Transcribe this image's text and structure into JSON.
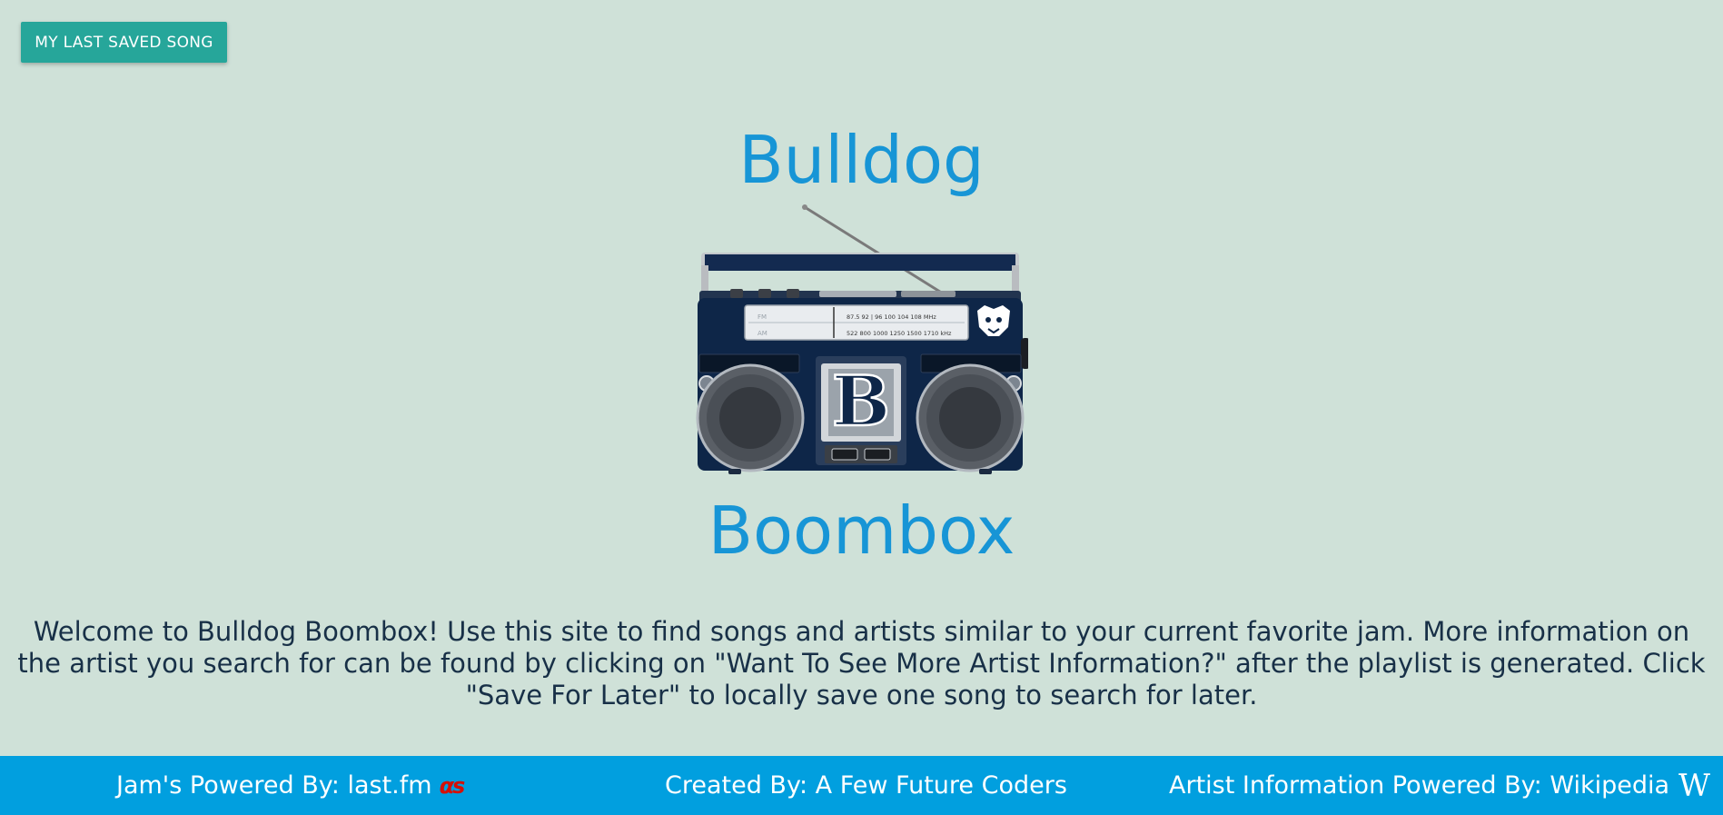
{
  "saved_button": {
    "label": "MY LAST SAVED SONG"
  },
  "title": {
    "line1": "Bulldog",
    "line2": "Boombox"
  },
  "boombox": {
    "letter": "B",
    "fm_label": "FM",
    "am_label": "AM",
    "fm_scale": "87.5  92  |  96   100  104  108   MHz",
    "am_scale": "522  800  1000  1250  1500  1710   kHz"
  },
  "welcome_text": "Welcome to Bulldog Boombox! Use this site to find songs and artists similar to your current favorite jam. More information on the artist you search for can be found by clicking on \"Want To See More Artist Information?\" after the playlist is generated. Click \"Save For Later\" to locally save one song to search for later.",
  "footer": {
    "left_text": "Jam's Powered By: last.fm",
    "left_icon": "lastfm-logo",
    "left_logo_text": "αs",
    "middle_text": "Created By: A Few Future Coders",
    "right_text": "Artist Information Powered By: Wikipedia",
    "right_icon": "wikipedia-logo",
    "right_logo_text": "W"
  },
  "colors": {
    "background": "#cfe1d8",
    "button": "#26a69a",
    "title": "#1795d6",
    "footer": "#019fdf",
    "body_text": "#183047",
    "lastfm_red": "#d51007",
    "boombox_navy": "#0e2648"
  }
}
